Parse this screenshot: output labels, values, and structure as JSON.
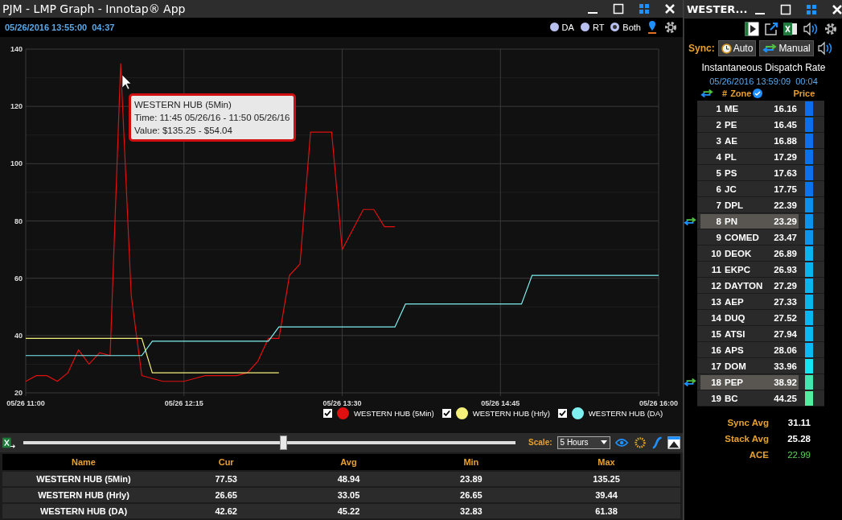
{
  "main_window": {
    "title": "PJM - LMP Graph - Innotap® App",
    "timestamp": "05/26/2016 13:55:00",
    "elapsed": "04:37",
    "modes": [
      {
        "label": "DA",
        "selected": false
      },
      {
        "label": "RT",
        "selected": false
      },
      {
        "label": "Both",
        "selected": true
      }
    ]
  },
  "chart": {
    "chart_data": {
      "type": "line",
      "categories": [
        "05/26 11:00",
        null,
        null,
        null,
        null,
        null,
        null,
        null,
        null,
        null,
        null,
        null,
        null,
        null,
        null,
        "05/26 12:15",
        null,
        null,
        null,
        null,
        null,
        null,
        null,
        null,
        null,
        null,
        null,
        null,
        null,
        null,
        "05/26 13:30",
        null,
        null,
        null,
        null,
        null,
        null,
        null,
        null,
        null,
        null,
        null,
        null,
        null,
        null,
        "05/26 14:45",
        null,
        null,
        null,
        null,
        null,
        null,
        null,
        null,
        null,
        null,
        null,
        null,
        null,
        null,
        "05/26 16:00"
      ],
      "grid": true,
      "ylim": [
        20,
        140
      ],
      "yticks": [
        20,
        40,
        60,
        80,
        100,
        120,
        140
      ],
      "series": [
        {
          "name": "WESTERN HUB (5Min)",
          "color": "#e01010",
          "values": [
            24,
            26,
            26,
            24,
            27,
            35,
            30,
            34,
            33,
            135,
            54,
            26,
            25,
            24,
            24,
            24,
            25,
            26,
            26,
            26,
            26,
            27,
            31,
            39,
            39,
            61,
            65,
            111,
            111,
            111,
            70,
            77,
            84,
            84,
            78,
            78,
            null,
            null,
            null,
            null,
            null,
            null,
            null,
            null,
            null,
            null,
            null,
            null,
            null,
            null,
            null,
            null,
            null,
            null,
            null,
            null,
            null,
            null,
            null,
            null,
            null
          ]
        },
        {
          "name": "WESTERN HUB (Hrly)",
          "color": "#f5f07a",
          "values": [
            39,
            39,
            39,
            39,
            39,
            39,
            39,
            39,
            39,
            39,
            39,
            39,
            27,
            27,
            27,
            27,
            27,
            27,
            27,
            27,
            27,
            27,
            27,
            27,
            27,
            null,
            null,
            null,
            null,
            null,
            null,
            null,
            null,
            null,
            null,
            null,
            null,
            null,
            null,
            null,
            null,
            null,
            null,
            null,
            null,
            null,
            null,
            null,
            null,
            null,
            null,
            null,
            null,
            null,
            null,
            null,
            null,
            null,
            null,
            null,
            null
          ]
        },
        {
          "name": "WESTERN HUB (DA)",
          "color": "#7ef0f0",
          "values": [
            33,
            33,
            33,
            33,
            33,
            33,
            33,
            33,
            33,
            33,
            33,
            33,
            38,
            38,
            38,
            38,
            38,
            38,
            38,
            38,
            38,
            38,
            38,
            38,
            43,
            43,
            43,
            43,
            43,
            43,
            43,
            43,
            43,
            43,
            43,
            43,
            51,
            51,
            51,
            51,
            51,
            51,
            51,
            51,
            51,
            51,
            51,
            51,
            61,
            61,
            61,
            61,
            61,
            61,
            61,
            61,
            61,
            61,
            61,
            61,
            61
          ]
        }
      ]
    },
    "legend": [
      {
        "checked": true
      },
      {
        "checked": true
      },
      {
        "checked": true
      }
    ],
    "tooltip": {
      "lines": [
        "WESTERN HUB (5Min)",
        "Time: 11:45 05/26/16 - 11:50 05/26/16",
        "Value: $135.25 - $54.04"
      ]
    }
  },
  "controls": {
    "slider": {
      "level": 0.53
    },
    "scale_label": "Scale:",
    "scale_value": "5 Hours"
  },
  "stats": {
    "columns": [
      "Name",
      "Cur",
      "Avg",
      "Min",
      "Max"
    ],
    "rows": [
      [
        "WESTERN HUB (5Min)",
        "77.53",
        "48.94",
        "23.89",
        "135.25"
      ],
      [
        "WESTERN HUB (Hrly)",
        "26.65",
        "33.05",
        "26.65",
        "39.44"
      ],
      [
        "WESTERN HUB (DA)",
        "42.62",
        "45.22",
        "32.83",
        "61.38"
      ]
    ]
  },
  "side_window": {
    "title": "WESTER...",
    "sync_label": "Sync:",
    "sync_buttons": [
      "Auto",
      "Manual"
    ],
    "heading": "Instantaneous Dispatch Rate",
    "timestamp": "05/26/2016 13:59:09",
    "elapsed": "00:04",
    "columns": [
      "#",
      "Zone",
      "Price"
    ],
    "zones": [
      {
        "num": "1",
        "zone": "ME",
        "price": "16.16",
        "color": "#0a6ef0",
        "selected": false
      },
      {
        "num": "2",
        "zone": "PE",
        "price": "16.45",
        "color": "#0a6ef0",
        "selected": false
      },
      {
        "num": "3",
        "zone": "AE",
        "price": "16.88",
        "color": "#0a70f0",
        "selected": false
      },
      {
        "num": "4",
        "zone": "PL",
        "price": "17.29",
        "color": "#0a72f0",
        "selected": false
      },
      {
        "num": "5",
        "zone": "PS",
        "price": "17.63",
        "color": "#0a72f0",
        "selected": false
      },
      {
        "num": "6",
        "zone": "JC",
        "price": "17.75",
        "color": "#0a74f0",
        "selected": false
      },
      {
        "num": "7",
        "zone": "DPL",
        "price": "22.39",
        "color": "#0a90f0",
        "selected": false
      },
      {
        "num": "8",
        "zone": "PN",
        "price": "23.29",
        "color": "#0a94f0",
        "selected": true
      },
      {
        "num": "9",
        "zone": "COMED",
        "price": "23.47",
        "color": "#0a96f0",
        "selected": false
      },
      {
        "num": "10",
        "zone": "DEOK",
        "price": "26.89",
        "color": "#0ab4f0",
        "selected": false
      },
      {
        "num": "11",
        "zone": "EKPC",
        "price": "26.93",
        "color": "#0ab4f0",
        "selected": false
      },
      {
        "num": "12",
        "zone": "DAYTON",
        "price": "27.29",
        "color": "#0ab6f0",
        "selected": false
      },
      {
        "num": "13",
        "zone": "AEP",
        "price": "27.33",
        "color": "#0ab6f0",
        "selected": false
      },
      {
        "num": "14",
        "zone": "DUQ",
        "price": "27.52",
        "color": "#0ab8f0",
        "selected": false
      },
      {
        "num": "15",
        "zone": "ATSI",
        "price": "27.94",
        "color": "#0abaf0",
        "selected": false
      },
      {
        "num": "16",
        "zone": "APS",
        "price": "28.06",
        "color": "#0abaf0",
        "selected": false
      },
      {
        "num": "17",
        "zone": "DOM",
        "price": "33.96",
        "color": "#14e6f0",
        "selected": false
      },
      {
        "num": "18",
        "zone": "PEP",
        "price": "38.92",
        "color": "#40e8b0",
        "selected": true
      },
      {
        "num": "19",
        "zone": "BC",
        "price": "44.25",
        "color": "#50f0a0",
        "selected": false
      }
    ],
    "summary": [
      {
        "label": "Sync Avg",
        "value": "31.11",
        "kind": "plain"
      },
      {
        "label": "Stack Avg",
        "value": "25.28",
        "kind": "plain"
      },
      {
        "label": "ACE",
        "value": "22.99",
        "kind": "highlight"
      }
    ]
  }
}
